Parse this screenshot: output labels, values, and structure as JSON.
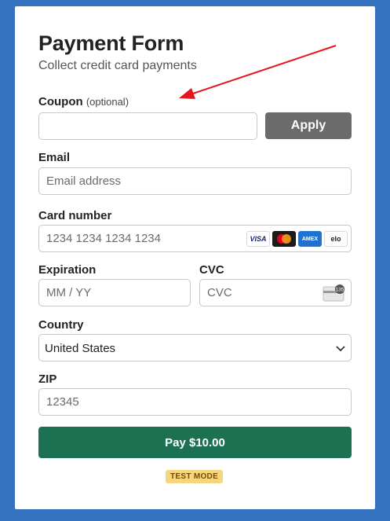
{
  "header": {
    "title": "Payment Form",
    "subtitle": "Collect credit card payments"
  },
  "coupon": {
    "label": "Coupon",
    "optional": "(optional)",
    "value": "",
    "apply_label": "Apply"
  },
  "email": {
    "label": "Email",
    "placeholder": "Email address"
  },
  "card": {
    "label": "Card number",
    "placeholder": "1234 1234 1234 1234",
    "brands": [
      "VISA",
      "mastercard-logo",
      "AMEX",
      "elo"
    ]
  },
  "expiration": {
    "label": "Expiration",
    "placeholder": "MM / YY"
  },
  "cvc": {
    "label": "CVC",
    "placeholder": "CVC",
    "icon_text": "135"
  },
  "country": {
    "label": "Country",
    "selected": "United States"
  },
  "zip": {
    "label": "ZIP",
    "placeholder": "12345"
  },
  "pay": {
    "label": "Pay $10.00"
  },
  "badge": {
    "label": "TEST MODE"
  },
  "colors": {
    "background": "#3572c0",
    "pay_button": "#1b7152",
    "apply_button": "#6b6b6b",
    "badge_bg": "#f6d67a",
    "annotation_arrow": "#e8141c"
  }
}
